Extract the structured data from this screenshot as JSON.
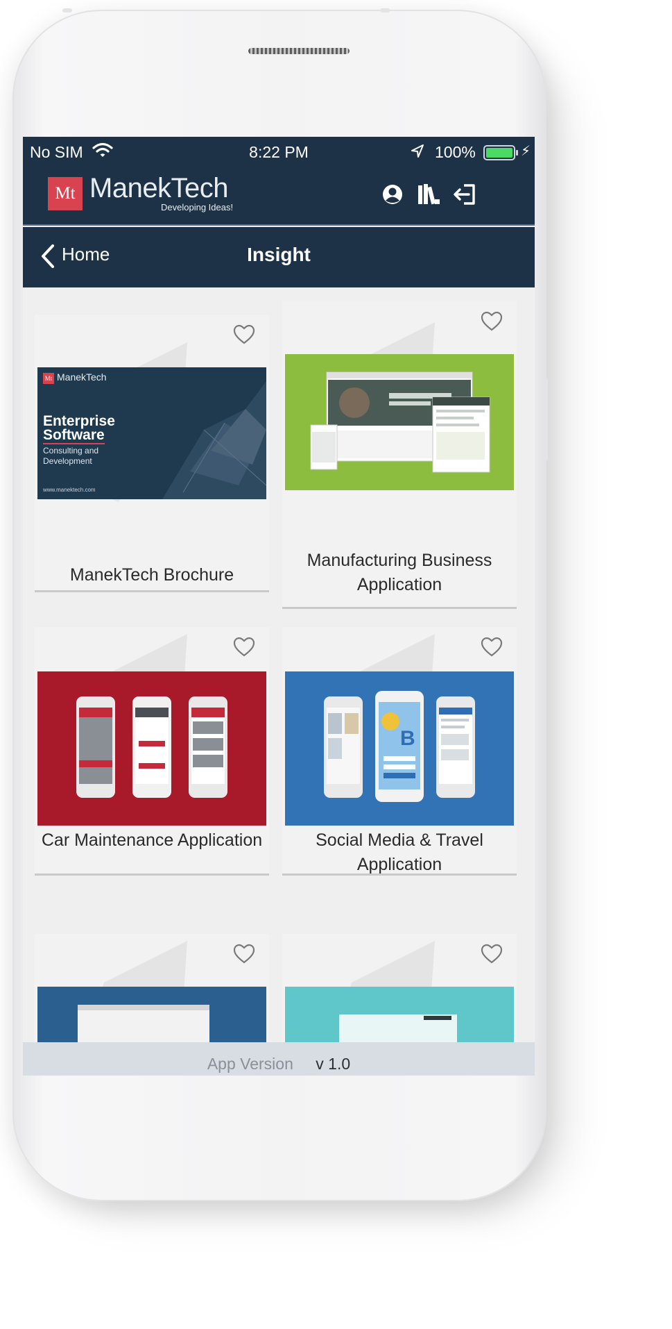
{
  "status_bar": {
    "carrier": "No SIM",
    "time": "8:22 PM",
    "battery": "100%"
  },
  "header": {
    "brand_mark": "Mt",
    "brand_name": "ManekTech",
    "tagline": "Developing Ideas!",
    "icons": [
      "user-icon",
      "books-icon",
      "logout-icon"
    ]
  },
  "nav": {
    "back_label": "Home",
    "title": "Insight"
  },
  "cards": [
    {
      "title": "ManekTech Brochure",
      "thumb_bg": "#1f3a4f",
      "thumb_logo": "ManekTech",
      "thumb_heading_1": "Enterprise",
      "thumb_heading_2": "Software",
      "thumb_sub_1": "Consulting and",
      "thumb_sub_2": "Development",
      "thumb_url": "www.manektech.com"
    },
    {
      "title": "Manufacturing Business Application",
      "thumb_bg": "#8cbd3e"
    },
    {
      "title": "Car Maintenance Application",
      "thumb_bg": "#a8192a"
    },
    {
      "title": "Social Media & Travel Application",
      "thumb_bg": "#3273b5"
    },
    {
      "title": "",
      "thumb_bg": "#2b5f8f"
    },
    {
      "title": "",
      "thumb_bg": "#5fc7c9"
    }
  ],
  "footer": {
    "label": "App Version",
    "version": "v 1.0"
  },
  "colors": {
    "header_bg": "#1d3247",
    "brand_red": "#d9434f",
    "battery_green": "#4cd964"
  }
}
